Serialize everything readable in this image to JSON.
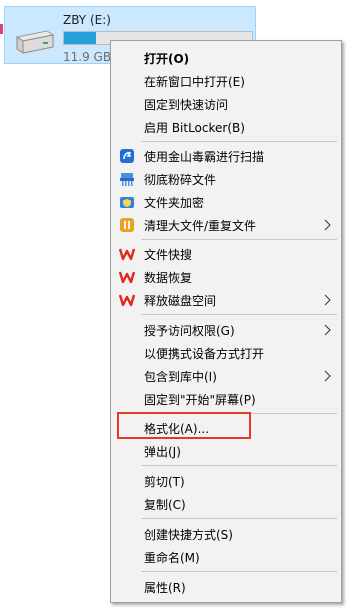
{
  "drive": {
    "name": "ZBY (E:)",
    "size_text": "11.9 GB",
    "used_fraction": 0.17,
    "icon": "hard-drive-icon"
  },
  "menu": {
    "items": [
      {
        "label": "打开(O)",
        "bold": true
      },
      {
        "label": "在新窗口中打开(E)"
      },
      {
        "label": "固定到快速访问"
      },
      {
        "label": "启用 BitLocker(B)"
      },
      {
        "label": "使用金山毒霸进行扫描",
        "icon": "jinshan-scan-icon"
      },
      {
        "label": "彻底粉碎文件",
        "icon": "shredder-icon"
      },
      {
        "label": "文件夹加密",
        "icon": "folder-lock-icon"
      },
      {
        "label": "清理大文件/重复文件",
        "icon": "cleanup-icon",
        "submenu": true
      },
      {
        "label": "文件快搜",
        "icon": "wps-icon"
      },
      {
        "label": "数据恢复",
        "icon": "wps-icon"
      },
      {
        "label": "释放磁盘空间",
        "icon": "wps-icon",
        "submenu": true
      },
      {
        "label": "授予访问权限(G)",
        "submenu": true
      },
      {
        "label": "以便携式设备方式打开"
      },
      {
        "label": "包含到库中(I)",
        "submenu": true
      },
      {
        "label": "固定到\"开始\"屏幕(P)"
      },
      {
        "label": "格式化(A)..."
      },
      {
        "label": "弹出(J)"
      },
      {
        "label": "剪切(T)"
      },
      {
        "label": "复制(C)"
      },
      {
        "label": "创建快捷方式(S)"
      },
      {
        "label": "重命名(M)"
      },
      {
        "label": "属性(R)"
      }
    ]
  },
  "colors": {
    "highlight_border": "#e8362b",
    "wps_red": "#e0281c",
    "accent_blue": "#2a7de1",
    "selection_bg": "#cce8ff"
  }
}
